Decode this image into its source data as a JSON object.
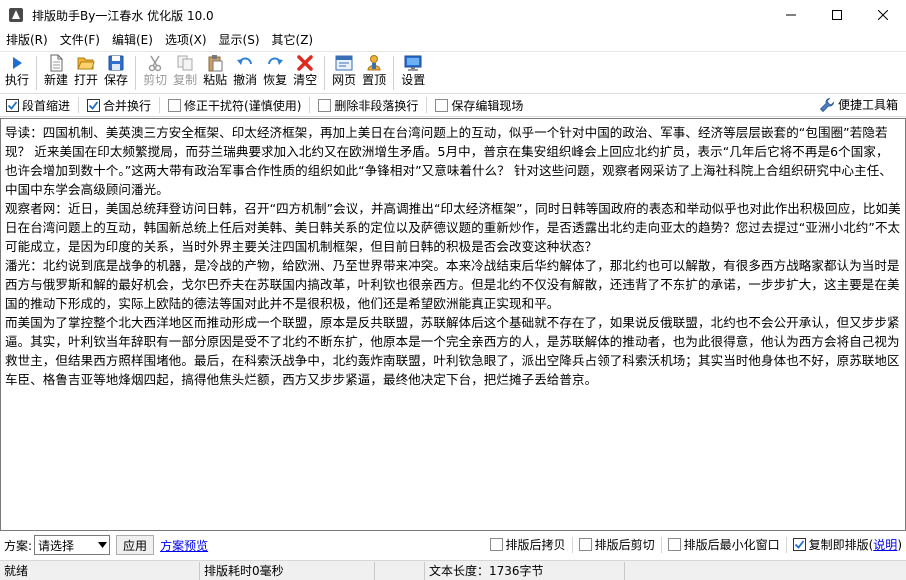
{
  "window": {
    "title": "排版助手By一江春水 优化版 10.0"
  },
  "menu": [
    "排版(R)",
    "文件(F)",
    "编辑(E)",
    "选项(X)",
    "显示(S)",
    "其它(Z)"
  ],
  "toolbar": {
    "run": "执行",
    "new": "新建",
    "open": "打开",
    "save": "保存",
    "cut": "剪切",
    "copy": "复制",
    "paste": "粘贴",
    "undo": "撤消",
    "redo": "恢复",
    "clear": "清空",
    "web": "网页",
    "pin": "置顶",
    "settings": "设置"
  },
  "options": {
    "indent": "段首缩进",
    "merge": "合并换行",
    "fix_break": "修正干扰符(谨慎使用)",
    "delete_nonpara": "删除非段落换行",
    "keep_scene": "保存编辑现场",
    "tools": "便捷工具箱"
  },
  "content": {
    "paragraphs": [
      "导读：四国机制、美英澳三方安全框架、印太经济框架，再加上美日在台湾问题上的互动，似乎一个针对中国的政治、军事、经济等层层嵌套的“包围圈”若隐若现？  近来美国在印太频繁搅局，而芬兰瑞典要求加入北约又在欧洲增生矛盾。5月中，普京在集安组织峰会上回应北约扩员，表示“几年后它将不再是6个国家，也许会增加到数十个。”这两大带有政治军事合作性质的组织如此“争锋相对”又意味着什么？  针对这些问题，观察者网采访了上海社科院上合组织研究中心主任、中国中东学会高级顾问潘光。",
      "观察者网：近日，美国总统拜登访问日韩，召开“四方机制”会议，并高调推出“印太经济框架”，同时日韩等国政府的表态和举动似乎也对此作出积极回应，比如美日在台湾问题上的互动，韩国新总统上任后对美韩、美日韩关系的定位以及萨德议题的重新炒作，是否透露出北约走向亚太的趋势？您过去提过“亚洲小北约”不太可能成立，是因为印度的关系，当时外界主要关注四国机制框架，但目前日韩的积极是否会改变这种状态？",
      "潘光：北约说到底是战争的机器，是冷战的产物，给欧洲、乃至世界带来冲突。本来冷战结束后华约解体了，那北约也可以解散，有很多西方战略家都认为当时是西方与俄罗斯和解的最好机会，戈尔巴乔夫在苏联国内搞改革，叶利钦也很亲西方。但是北约不仅没有解散，还违背了不东扩的承诺，一步步扩大，这主要是在美国的推动下形成的，实际上欧陆的德法等国对此并不是很积极，他们还是希望欧洲能真正实现和平。",
      "而美国为了掌控整个北大西洋地区而推动形成一个联盟，原本是反共联盟，苏联解体后这个基础就不存在了，如果说反俄联盟，北约也不会公开承认，但又步步紧逼。其实，叶利钦当年辞职有一部分原因是受不了北约不断东扩，他原本是一个完全亲西方的人，是苏联解体的推动者，也为此很得意，他认为西方会将自己视为救世主，但结果西方照样围堵他。最后，在科索沃战争中，北约轰炸南联盟，叶利钦急眼了，派出空降兵占领了科索沃机场；其实当时他身体也不好，原苏联地区车臣、格鲁吉亚等地烽烟四起，搞得他焦头烂额，西方又步步紧逼，最终他决定下台，把烂摊子丢给普京。"
    ]
  },
  "scheme": {
    "label": "方案:",
    "selected": "请选择",
    "apply": "应用",
    "preview": "方案预览",
    "copy_after": "排版后拷贝",
    "cut_after": "排版后剪切",
    "minimize_after": "排版后最小化窗口",
    "copy_immediate": "复制即排版",
    "help": "说明"
  },
  "status": {
    "state": "就绪",
    "time": "排版耗时0毫秒",
    "length": "文本长度：1736字节"
  },
  "colors": {
    "accent_blue": "#1e6fd0",
    "link": "#0000ee"
  }
}
